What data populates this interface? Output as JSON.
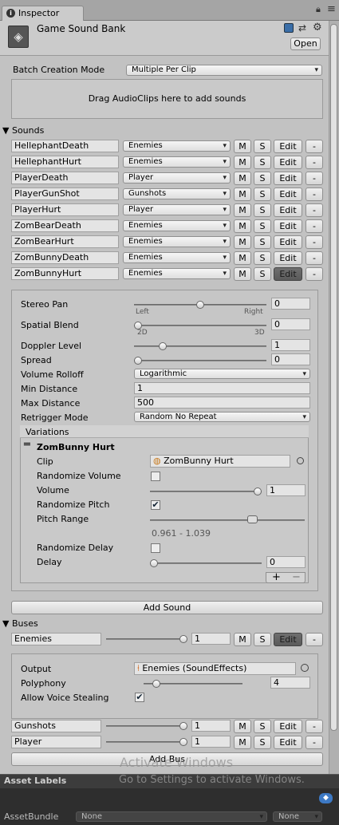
{
  "window": {
    "tab_title": "Inspector",
    "open_label": "Open"
  },
  "component": {
    "title": "Game Sound Bank"
  },
  "batch": {
    "label": "Batch Creation Mode",
    "value": "Multiple Per Clip",
    "drop_text": "Drag AudioClips here to add sounds"
  },
  "sounds": {
    "header": "Sounds",
    "m": "M",
    "s": "S",
    "edit": "Edit",
    "minus": "-",
    "items": [
      {
        "name": "HellephantDeath",
        "bus": "Enemies"
      },
      {
        "name": "HellephantHurt",
        "bus": "Enemies"
      },
      {
        "name": "PlayerDeath",
        "bus": "Player"
      },
      {
        "name": "PlayerGunShot",
        "bus": "Gunshots"
      },
      {
        "name": "PlayerHurt",
        "bus": "Player"
      },
      {
        "name": "ZomBearDeath",
        "bus": "Enemies"
      },
      {
        "name": "ZomBearHurt",
        "bus": "Enemies"
      },
      {
        "name": "ZomBunnyDeath",
        "bus": "Enemies"
      },
      {
        "name": "ZomBunnyHurt",
        "bus": "Enemies"
      }
    ]
  },
  "details": {
    "stereo_pan": {
      "label": "Stereo Pan",
      "value": "0",
      "left": "Left",
      "right": "Right",
      "level": 0.5
    },
    "spatial_blend": {
      "label": "Spatial Blend",
      "value": "0",
      "min": "2D",
      "max": "3D",
      "level": 0
    },
    "doppler": {
      "label": "Doppler Level",
      "value": "1",
      "level": 0.2
    },
    "spread": {
      "label": "Spread",
      "value": "0",
      "level": 0
    },
    "rolloff": {
      "label": "Volume Rolloff",
      "value": "Logarithmic"
    },
    "min_distance": {
      "label": "Min Distance",
      "value": "1"
    },
    "max_distance": {
      "label": "Max Distance",
      "value": "500"
    },
    "retrigger": {
      "label": "Retrigger Mode",
      "value": "Random No Repeat"
    },
    "variations": {
      "header": "Variations",
      "name": "ZomBunny Hurt",
      "clip_label": "Clip",
      "clip_value": "ZomBunny Hurt",
      "rand_volume_label": "Randomize Volume",
      "rand_volume": false,
      "volume_label": "Volume",
      "volume_value": "1",
      "volume_level": 1,
      "rand_pitch_label": "Randomize Pitch",
      "rand_pitch": true,
      "pitch_range_label": "Pitch Range",
      "pitch_range_text": "0.961 - 1.039",
      "rand_delay_label": "Randomize Delay",
      "rand_delay": false,
      "delay_label": "Delay",
      "delay_value": "0",
      "delay_level": 0,
      "plus": "+",
      "minus": "−"
    }
  },
  "add_sound": "Add Sound",
  "buses": {
    "header": "Buses",
    "m": "M",
    "s": "S",
    "edit": "Edit",
    "minus": "-",
    "items": [
      {
        "name": "Enemies",
        "volume": "1",
        "level": 1
      },
      {
        "name": "Gunshots",
        "volume": "1",
        "level": 1
      },
      {
        "name": "Player",
        "volume": "1",
        "level": 1
      }
    ],
    "output_label": "Output",
    "output_value": "Enemies (SoundEffects)",
    "polyphony_label": "Polyphony",
    "polyphony_value": "4",
    "polyphony_level": 0.1,
    "steal_label": "Allow Voice Stealing",
    "steal": true
  },
  "add_bus": "Add Bus",
  "footer": {
    "asset_labels": "Asset Labels",
    "assetbundle_label": "AssetBundle",
    "bundle_value": "None",
    "variant_value": "None"
  },
  "watermark": {
    "line1": "Activate Windows",
    "line2": "Go to Settings to activate Windows."
  }
}
